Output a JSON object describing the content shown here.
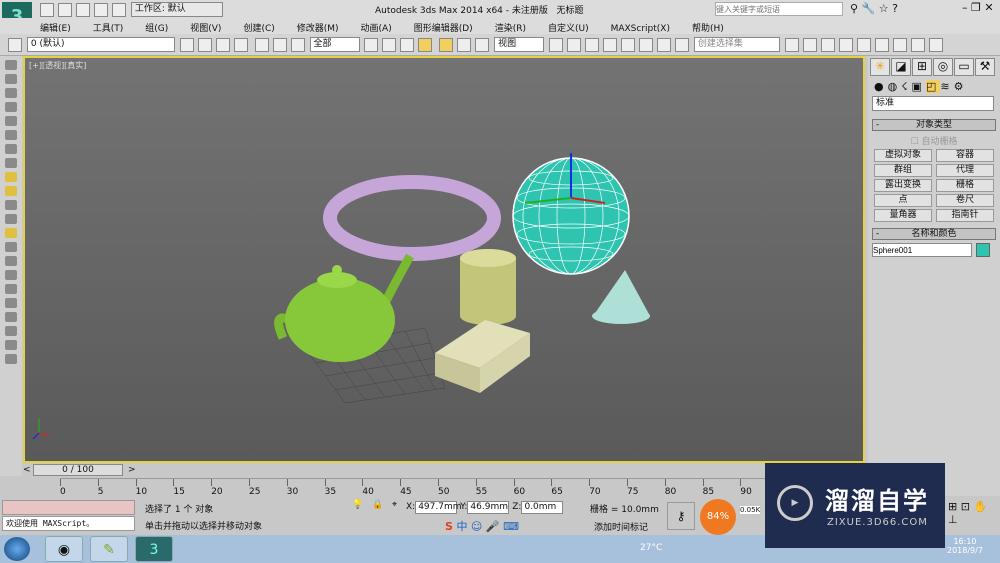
{
  "title": {
    "workspace": "工作区: 默认",
    "app": "Autodesk 3ds Max  2014 x64",
    "version": "- 未注册版",
    "doc": "无标题",
    "search_placeholder": "键入关键字或短语"
  },
  "menu": [
    "编辑(E)",
    "工具(T)",
    "组(G)",
    "视图(V)",
    "创建(C)",
    "修改器(M)",
    "动画(A)",
    "图形编辑器(D)",
    "渲染(R)",
    "自定义(U)",
    "MAXScript(X)",
    "帮助(H)"
  ],
  "toolbar": {
    "layer": "0 (默认)",
    "filter": "全部",
    "ref_coord": "视图",
    "selection_set": "创建选择集"
  },
  "viewport": {
    "label": "[+][透视][真实]"
  },
  "command_panel": {
    "category": "标准",
    "rollout_object_type": "对象类型",
    "auto_grid": "自动栅格",
    "buttons": [
      "虚拟对象",
      "容器",
      "群组",
      "代理",
      "露出变换",
      "栅格",
      "点",
      "卷尺",
      "量角器",
      "指南针"
    ],
    "rollout_name_color": "名称和颜色",
    "object_name": "Sphere001",
    "object_color": "#2ec4b0"
  },
  "timeline": {
    "frame": "0 / 100",
    "ticks": [
      "0",
      "5",
      "10",
      "15",
      "20",
      "25",
      "30",
      "35",
      "40",
      "45",
      "50",
      "55",
      "60",
      "65",
      "70",
      "75",
      "80",
      "85",
      "90"
    ]
  },
  "status": {
    "maxscript": "欢迎使用 MAXScript。",
    "selected": "选择了 1 个 对象",
    "prompt": "单击并拖动以选择并移动对象",
    "x": "497.7mm",
    "y": "46.9mm",
    "z": "0.0mm",
    "grid": "栅格 = 10.0mm",
    "add_time_tag": "添加时间标记",
    "perf": "84%",
    "net_up": "0.05K",
    "ime": "中"
  },
  "taskbar": {
    "weather": "27°C",
    "time": "16:10",
    "date": "2018/9/7"
  },
  "watermark": {
    "brand": "溜溜自学",
    "url": "ZIXUE.3D66.COM"
  }
}
